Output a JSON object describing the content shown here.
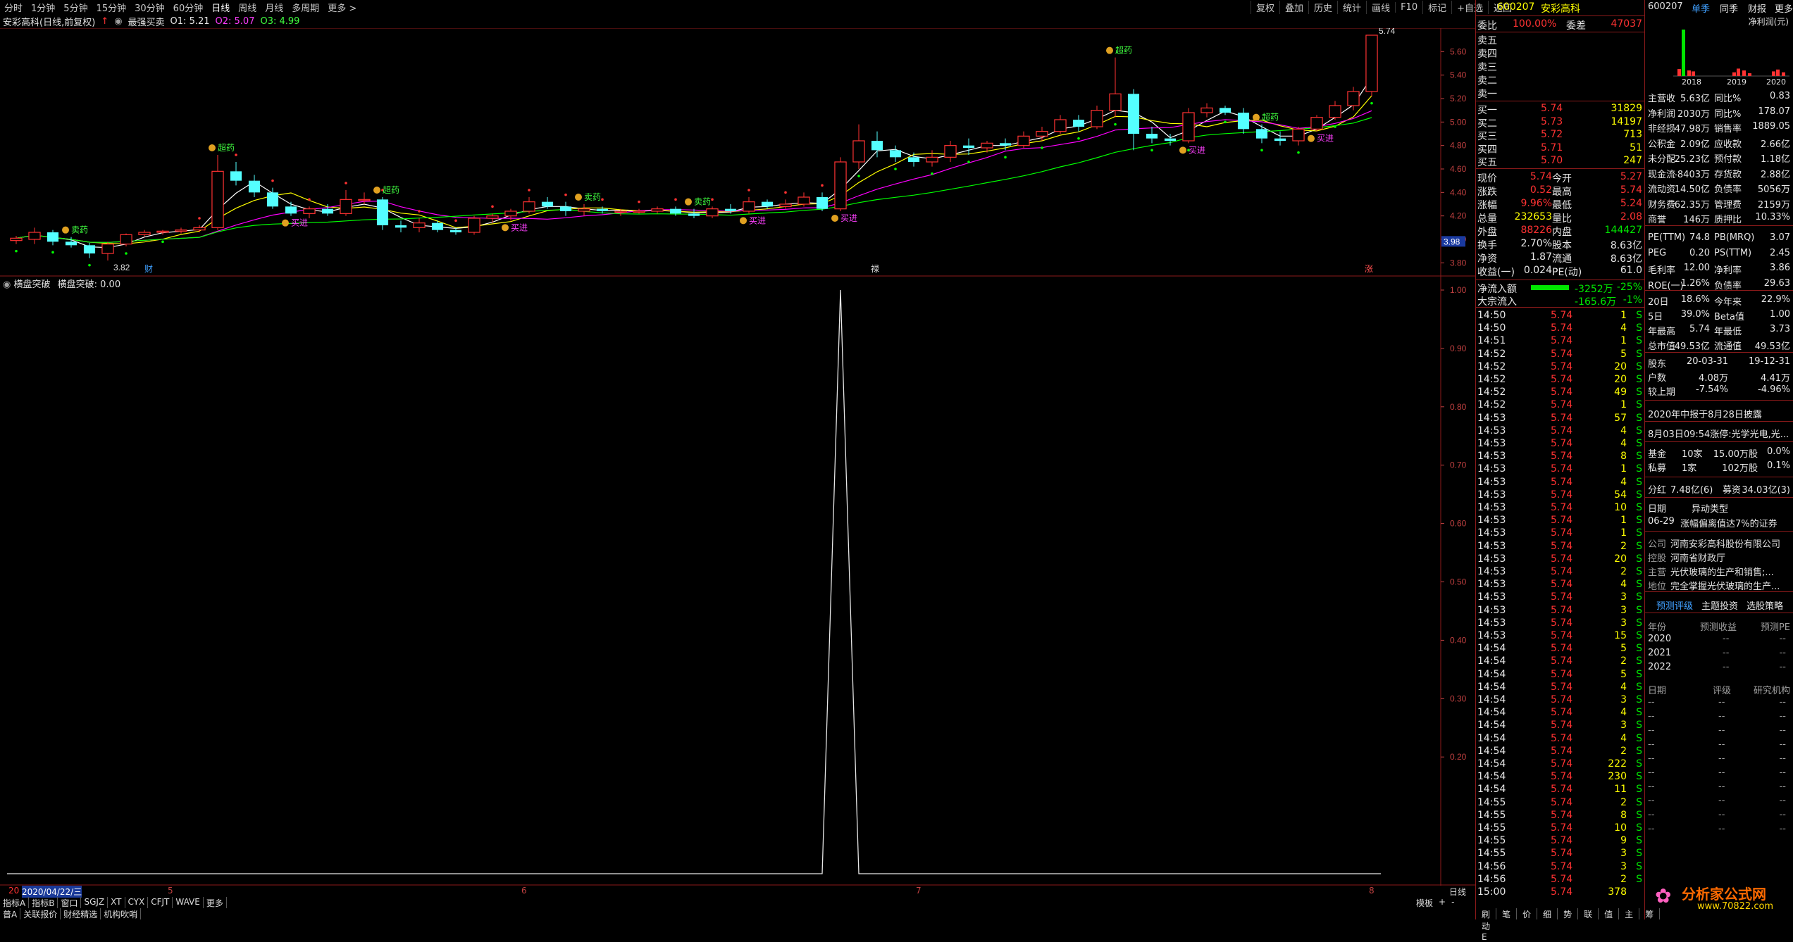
{
  "top_tabs": [
    "分时",
    "1分钟",
    "5分钟",
    "15分钟",
    "30分钟",
    "60分钟",
    "日线",
    "周线",
    "月线",
    "多周期",
    "更多 >"
  ],
  "right_tools": [
    "复权",
    "叠加",
    "历史",
    "统计",
    "画线",
    "F10",
    "标记",
    "+自选",
    "返回"
  ],
  "chart_header": {
    "title": "安彩高科(日线,前复权)",
    "indicator": "最强买卖",
    "o1": "O1: 5.21",
    "o2": "O2: 5.07",
    "o3": "O3: 4.99"
  },
  "price_axis": [
    "5.60",
    "5.40",
    "5.20",
    "5.00",
    "4.80",
    "4.60",
    "4.40",
    "4.20",
    "4.00",
    "3.98",
    "3.80"
  ],
  "price_labels": {
    "high": "5.74",
    "low": "3.82"
  },
  "markers": {
    "cai": "财",
    "lu": "禄",
    "zhang": "涨"
  },
  "signals": {
    "buy": "买进",
    "sell": "卖药",
    "chao": "超药"
  },
  "sub_header": {
    "name": "横盘突破",
    "value_label": "横盘突破: 0.00"
  },
  "sub_axis": [
    "1.00",
    "0.90",
    "0.80",
    "0.70",
    "0.60",
    "0.50",
    "0.40",
    "0.30",
    "0.20"
  ],
  "date_axis": {
    "start": "2020/04/22/三",
    "ticks": [
      "5",
      "6",
      "7",
      "8"
    ],
    "ticks_prefix": "20",
    "mode": "日线"
  },
  "bottom_tabs": [
    "指标A",
    "指标B",
    "窗口",
    "SGJZ",
    "XT",
    "CYX",
    "CFJT",
    "WAVE",
    "更多"
  ],
  "bottom_tabs2": [
    "普A",
    "关联报价",
    "财经精选",
    "机构吹哨"
  ],
  "bottom_right": [
    "模板",
    "+",
    "-"
  ],
  "chart_data": {
    "type": "candlestick",
    "title": "安彩高科(日线,前复权)",
    "ylim": [
      3.7,
      5.8
    ],
    "candles": [
      [
        3.99,
        4.03,
        3.96,
        4.01
      ],
      [
        4.0,
        4.1,
        3.96,
        4.06
      ],
      [
        4.06,
        4.08,
        3.95,
        3.98
      ],
      [
        3.98,
        4.02,
        3.93,
        3.95
      ],
      [
        3.95,
        3.97,
        3.84,
        3.88
      ],
      [
        3.88,
        3.98,
        3.82,
        3.96
      ],
      [
        3.96,
        4.05,
        3.94,
        4.04
      ],
      [
        4.04,
        4.08,
        4.02,
        4.06
      ],
      [
        4.06,
        4.08,
        4.04,
        4.07
      ],
      [
        4.07,
        4.1,
        4.05,
        4.08
      ],
      [
        4.08,
        4.12,
        4.06,
        4.1
      ],
      [
        4.1,
        4.72,
        4.08,
        4.58
      ],
      [
        4.58,
        4.66,
        4.46,
        4.5
      ],
      [
        4.5,
        4.55,
        4.36,
        4.4
      ],
      [
        4.4,
        4.44,
        4.26,
        4.28
      ],
      [
        4.28,
        4.32,
        4.2,
        4.22
      ],
      [
        4.22,
        4.28,
        4.18,
        4.26
      ],
      [
        4.26,
        4.3,
        4.2,
        4.22
      ],
      [
        4.22,
        4.42,
        4.2,
        4.34
      ],
      [
        4.34,
        4.4,
        4.3,
        4.34
      ],
      [
        4.34,
        4.36,
        4.08,
        4.12
      ],
      [
        4.12,
        4.16,
        4.06,
        4.1
      ],
      [
        4.1,
        4.18,
        4.06,
        4.14
      ],
      [
        4.14,
        4.16,
        4.06,
        4.08
      ],
      [
        4.08,
        4.1,
        4.04,
        4.06
      ],
      [
        4.06,
        4.2,
        4.04,
        4.18
      ],
      [
        4.18,
        4.22,
        4.14,
        4.2
      ],
      [
        4.2,
        4.26,
        4.16,
        4.24
      ],
      [
        4.24,
        4.36,
        4.22,
        4.32
      ],
      [
        4.32,
        4.36,
        4.26,
        4.28
      ],
      [
        4.28,
        4.32,
        4.2,
        4.24
      ],
      [
        4.24,
        4.3,
        4.2,
        4.26
      ],
      [
        4.26,
        4.28,
        4.22,
        4.24
      ],
      [
        4.24,
        4.26,
        4.2,
        4.24
      ],
      [
        4.24,
        4.26,
        4.22,
        4.24
      ],
      [
        4.24,
        4.28,
        4.22,
        4.26
      ],
      [
        4.26,
        4.28,
        4.2,
        4.22
      ],
      [
        4.22,
        4.26,
        4.18,
        4.2
      ],
      [
        4.2,
        4.28,
        4.18,
        4.26
      ],
      [
        4.26,
        4.3,
        4.22,
        4.24
      ],
      [
        4.24,
        4.36,
        4.22,
        4.32
      ],
      [
        4.32,
        4.34,
        4.26,
        4.28
      ],
      [
        4.28,
        4.34,
        4.26,
        4.3
      ],
      [
        4.3,
        4.4,
        4.28,
        4.36
      ],
      [
        4.36,
        4.4,
        4.24,
        4.26
      ],
      [
        4.26,
        4.7,
        4.24,
        4.66
      ],
      [
        4.66,
        4.98,
        4.6,
        4.84
      ],
      [
        4.84,
        4.92,
        4.7,
        4.76
      ],
      [
        4.76,
        4.8,
        4.66,
        4.7
      ],
      [
        4.7,
        4.74,
        4.62,
        4.66
      ],
      [
        4.66,
        4.76,
        4.62,
        4.7
      ],
      [
        4.7,
        4.84,
        4.66,
        4.8
      ],
      [
        4.8,
        4.86,
        4.72,
        4.78
      ],
      [
        4.78,
        4.84,
        4.74,
        4.82
      ],
      [
        4.82,
        4.86,
        4.76,
        4.8
      ],
      [
        4.8,
        4.92,
        4.78,
        4.88
      ],
      [
        4.88,
        4.96,
        4.84,
        4.92
      ],
      [
        4.92,
        5.06,
        4.9,
        5.02
      ],
      [
        5.02,
        5.06,
        4.92,
        4.96
      ],
      [
        4.96,
        5.14,
        4.94,
        5.1
      ],
      [
        5.1,
        5.55,
        5.04,
        5.24
      ],
      [
        5.24,
        5.28,
        4.76,
        4.9
      ],
      [
        4.9,
        4.96,
        4.82,
        4.86
      ],
      [
        4.86,
        4.9,
        4.8,
        4.84
      ],
      [
        4.84,
        5.12,
        4.82,
        5.08
      ],
      [
        5.08,
        5.16,
        5.04,
        5.12
      ],
      [
        5.12,
        5.14,
        5.06,
        5.08
      ],
      [
        5.08,
        5.12,
        4.9,
        4.94
      ],
      [
        4.94,
        4.98,
        4.82,
        4.86
      ],
      [
        4.86,
        4.92,
        4.8,
        4.84
      ],
      [
        4.84,
        4.96,
        4.8,
        4.94
      ],
      [
        4.94,
        5.06,
        4.92,
        5.04
      ],
      [
        5.04,
        5.18,
        5.02,
        5.14
      ],
      [
        5.14,
        5.3,
        5.1,
        5.26
      ],
      [
        5.26,
        5.74,
        5.22,
        5.74
      ]
    ],
    "sub_series": {
      "name": "横盘突破",
      "spike_index": 45,
      "values_note": "0 except 1 at spike"
    }
  },
  "quote": {
    "code": "600207",
    "name": "安彩高科",
    "weibi": "委比",
    "weibi_val": "100.00%",
    "weicha": "委差",
    "weicha_val": "47037",
    "sells": [
      {
        "label": "卖五"
      },
      {
        "label": "卖四"
      },
      {
        "label": "卖三"
      },
      {
        "label": "卖二"
      },
      {
        "label": "卖一"
      }
    ],
    "buys": [
      {
        "label": "买一",
        "price": "5.74",
        "vol": "31829"
      },
      {
        "label": "买二",
        "price": "5.73",
        "vol": "14197"
      },
      {
        "label": "买三",
        "price": "5.72",
        "vol": "713"
      },
      {
        "label": "买四",
        "price": "5.71",
        "vol": "51"
      },
      {
        "label": "买五",
        "price": "5.70",
        "vol": "247"
      }
    ],
    "stats": [
      {
        "l1": "现价",
        "v1": "5.74",
        "c1": "red",
        "l2": "今开",
        "v2": "5.27",
        "c2": "red"
      },
      {
        "l1": "涨跌",
        "v1": "0.52",
        "c1": "red",
        "l2": "最高",
        "v2": "5.74",
        "c2": "red"
      },
      {
        "l1": "涨幅",
        "v1": "9.96%",
        "c1": "red",
        "l2": "最低",
        "v2": "5.24",
        "c2": "red"
      },
      {
        "l1": "总量",
        "v1": "232653",
        "c1": "yellow",
        "l2": "量比",
        "v2": "2.08",
        "c2": "red"
      },
      {
        "l1": "外盘",
        "v1": "88226",
        "c1": "red",
        "l2": "内盘",
        "v2": "144427",
        "c2": "green"
      },
      {
        "l1": "换手",
        "v1": "2.70%",
        "c1": "white",
        "l2": "股本",
        "v2": "8.63亿",
        "c2": "white"
      },
      {
        "l1": "净资",
        "v1": "1.87",
        "c1": "white",
        "l2": "流通",
        "v2": "8.63亿",
        "c2": "white"
      },
      {
        "l1": "收益(一)",
        "v1": "0.024",
        "c1": "white",
        "l2": "PE(动)",
        "v2": "61.0",
        "c2": "white"
      }
    ],
    "netflow": [
      {
        "label": "净流入额",
        "val": "-3252万",
        "pct": "-25%"
      },
      {
        "label": "大宗流入",
        "val": "-165.6万",
        "pct": "-1%"
      }
    ],
    "ticks": [
      [
        "14:50",
        "5.74",
        "1",
        "S"
      ],
      [
        "14:50",
        "5.74",
        "4",
        "S"
      ],
      [
        "14:51",
        "5.74",
        "1",
        "S"
      ],
      [
        "14:52",
        "5.74",
        "5",
        "S"
      ],
      [
        "14:52",
        "5.74",
        "20",
        "S"
      ],
      [
        "14:52",
        "5.74",
        "20",
        "S"
      ],
      [
        "14:52",
        "5.74",
        "49",
        "S"
      ],
      [
        "14:52",
        "5.74",
        "1",
        "S"
      ],
      [
        "14:53",
        "5.74",
        "57",
        "S"
      ],
      [
        "14:53",
        "5.74",
        "4",
        "S"
      ],
      [
        "14:53",
        "5.74",
        "4",
        "S"
      ],
      [
        "14:53",
        "5.74",
        "8",
        "S"
      ],
      [
        "14:53",
        "5.74",
        "1",
        "S"
      ],
      [
        "14:53",
        "5.74",
        "4",
        "S"
      ],
      [
        "14:53",
        "5.74",
        "54",
        "S"
      ],
      [
        "14:53",
        "5.74",
        "10",
        "S"
      ],
      [
        "14:53",
        "5.74",
        "1",
        "S"
      ],
      [
        "14:53",
        "5.74",
        "1",
        "S"
      ],
      [
        "14:53",
        "5.74",
        "2",
        "S"
      ],
      [
        "14:53",
        "5.74",
        "20",
        "S"
      ],
      [
        "14:53",
        "5.74",
        "2",
        "S"
      ],
      [
        "14:53",
        "5.74",
        "4",
        "S"
      ],
      [
        "14:53",
        "5.74",
        "3",
        "S"
      ],
      [
        "14:53",
        "5.74",
        "3",
        "S"
      ],
      [
        "14:53",
        "5.74",
        "3",
        "S"
      ],
      [
        "14:53",
        "5.74",
        "15",
        "S"
      ],
      [
        "14:54",
        "5.74",
        "5",
        "S"
      ],
      [
        "14:54",
        "5.74",
        "2",
        "S"
      ],
      [
        "14:54",
        "5.74",
        "5",
        "S"
      ],
      [
        "14:54",
        "5.74",
        "4",
        "S"
      ],
      [
        "14:54",
        "5.74",
        "3",
        "S"
      ],
      [
        "14:54",
        "5.74",
        "4",
        "S"
      ],
      [
        "14:54",
        "5.74",
        "3",
        "S"
      ],
      [
        "14:54",
        "5.74",
        "4",
        "S"
      ],
      [
        "14:54",
        "5.74",
        "2",
        "S"
      ],
      [
        "14:54",
        "5.74",
        "222",
        "S"
      ],
      [
        "14:54",
        "5.74",
        "230",
        "S"
      ],
      [
        "14:54",
        "5.74",
        "11",
        "S"
      ],
      [
        "14:55",
        "5.74",
        "2",
        "S"
      ],
      [
        "14:55",
        "5.74",
        "8",
        "S"
      ],
      [
        "14:55",
        "5.74",
        "10",
        "S"
      ],
      [
        "14:55",
        "5.74",
        "9",
        "S"
      ],
      [
        "14:55",
        "5.74",
        "3",
        "S"
      ],
      [
        "14:56",
        "5.74",
        "3",
        "S"
      ],
      [
        "14:56",
        "5.74",
        "2",
        "S"
      ],
      [
        "15:00",
        "5.74",
        "378",
        ""
      ]
    ]
  },
  "info": {
    "code": "600207",
    "tabs": [
      "单季",
      "同季",
      "财报",
      "更多"
    ],
    "chart_title": "净利润(元)",
    "years": [
      "2018",
      "2019",
      "2020"
    ],
    "bars": [
      0.15,
      1.0,
      0.12,
      0.1,
      0.08,
      0.16,
      0.12,
      0.06,
      0.1,
      0.14,
      0.08
    ],
    "fin": [
      [
        "主营收",
        "5.63亿",
        "同比%",
        "0.83"
      ],
      [
        "净利润",
        "2030万",
        "同比%",
        "178.07"
      ],
      [
        "非经损",
        "47.98万",
        "销售率",
        "1889.05"
      ],
      [
        "公积金",
        "2.09亿",
        "应收款",
        "2.66亿"
      ],
      [
        "未分配",
        "-25.23亿",
        "预付款",
        "1.18亿"
      ],
      [
        "现金流",
        "-8403万",
        "存货款",
        "2.88亿"
      ],
      [
        "流动资",
        "14.50亿",
        "负债率",
        "5056万"
      ],
      [
        "财务费",
        "-62.35万",
        "管理费",
        "2159万"
      ],
      [
        "商誉",
        "146万",
        "质押比",
        "10.33%"
      ]
    ],
    "valuation": [
      [
        "PE(TTM)",
        "74.8",
        "PB(MRQ)",
        "3.07"
      ],
      [
        "PEG",
        "0.20",
        "PS(TTM)",
        "2.45"
      ],
      [
        "毛利率",
        "12.00",
        "净利率",
        "3.86"
      ],
      [
        "ROE(一)",
        "1.26%",
        "负债率",
        "29.63"
      ]
    ],
    "perf": [
      [
        "20日",
        "18.6%",
        "今年来",
        "22.9%"
      ],
      [
        "5日",
        "39.0%",
        "Beta值",
        "1.00"
      ],
      [
        "年最高",
        "5.74",
        "年最低",
        "3.73"
      ],
      [
        "总市值",
        "49.53亿",
        "流通值",
        "49.53亿"
      ]
    ],
    "holders": [
      [
        "股东",
        "20-03-31",
        "19-12-31"
      ],
      [
        "户数",
        "4.08万",
        "4.41万"
      ],
      [
        "较上期",
        "-7.54%",
        "-4.96%"
      ]
    ],
    "news1": "2020年中报于8月28日披露",
    "news2": "8月03日09:54涨停:光学光电,光...",
    "funds": [
      [
        "基金",
        "10家",
        "15.00万股",
        "0.0%"
      ],
      [
        "私募",
        "1家",
        "102万股",
        "0.1%"
      ]
    ],
    "dividend": [
      "分红",
      "7.48亿(6)",
      "募资",
      "34.03亿(3)"
    ],
    "anomaly_head": [
      "日期",
      "异动类型"
    ],
    "anomaly": [
      "06-29",
      "涨幅偏离值达7%的证券"
    ],
    "company": [
      [
        "公司",
        "河南安彩高科股份有限公司"
      ],
      [
        "控股",
        "河南省财政厅"
      ],
      [
        "主营",
        "光伏玻璃的生产和销售;..."
      ],
      [
        "地位",
        "完全掌握光伏玻璃的生产..."
      ]
    ],
    "sub_tabs": [
      "预测评级",
      "主题投资",
      "选股策略"
    ],
    "forecast_head": [
      "年份",
      "预测收益",
      "预测PE"
    ],
    "forecast": [
      [
        "2020",
        "--",
        "--"
      ],
      [
        "2021",
        "--",
        "--"
      ],
      [
        "2022",
        "--",
        "--"
      ]
    ],
    "rating_head": [
      "日期",
      "评级",
      "研究机构"
    ],
    "rating_rows": 10,
    "logo": "分析家公式网",
    "logo_url": "www.70822.com"
  },
  "right_bottom_tabs": [
    "刷动E",
    "笔",
    "价",
    "细",
    "势",
    "联",
    "值",
    "主",
    "筹"
  ],
  "colors": {
    "up": "#ff3232",
    "down": "#54ffff",
    "ma1": "#ffffff",
    "ma2": "#ffff00",
    "ma3": "#ff00ff",
    "ma4": "#00ff00",
    "grid": "#8b1a1a"
  }
}
